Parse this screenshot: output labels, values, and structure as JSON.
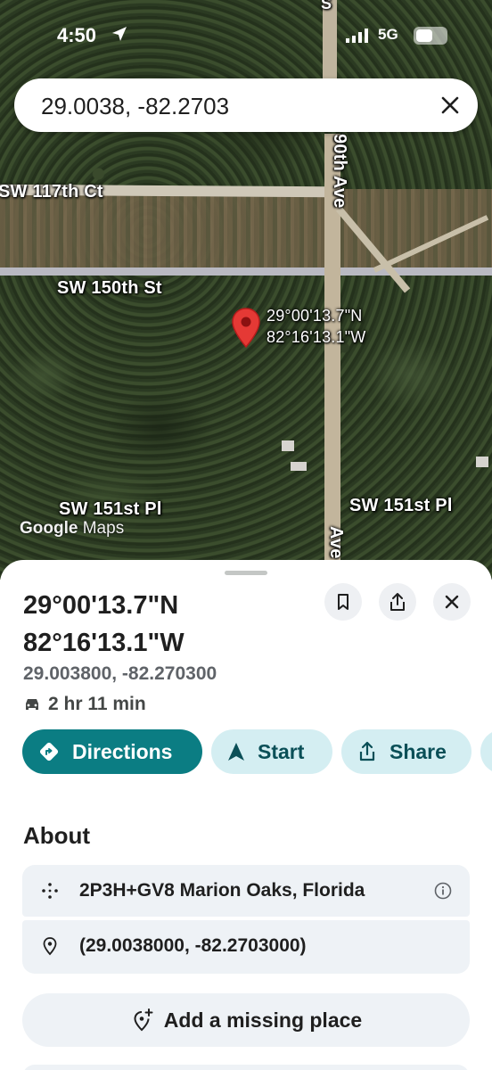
{
  "status_bar": {
    "time": "4:50",
    "network": "5G"
  },
  "search": {
    "query": "29.0038, -82.2703"
  },
  "map": {
    "street_labels": {
      "sw_117th_ct": "SW 117th Ct",
      "sw_150th_st": "SW 150th St",
      "sw_151st_pl_left": "SW 151st Pl",
      "sw_151st_pl_right": "SW 151st Pl",
      "ave_90th": "90th Ave",
      "ave_lower": "Ave",
      "top_s": "S"
    },
    "pin_label_lat": "29°00'13.7\"N",
    "pin_label_lng": "82°16'13.1\"W",
    "attribution_google": "Google",
    "attribution_maps": "Maps",
    "pin_color": "#e53935"
  },
  "place": {
    "title_lat": "29°00'13.7\"N",
    "title_lng": "82°16'13.1\"W",
    "decimal": "29.003800, -82.270300",
    "drive_time": "2 hr 11 min"
  },
  "actions": {
    "directions": "Directions",
    "start": "Start",
    "share": "Share"
  },
  "about": {
    "heading": "About",
    "plus_code": "2P3H+GV8 Marion Oaks, Florida",
    "coordinates": "(29.0038000, -82.2703000)"
  },
  "add_place": {
    "label": "Add a missing place"
  },
  "colors": {
    "accent": "#0b7d83",
    "accent_light": "#d4eef2",
    "card": "#eef2f6"
  }
}
